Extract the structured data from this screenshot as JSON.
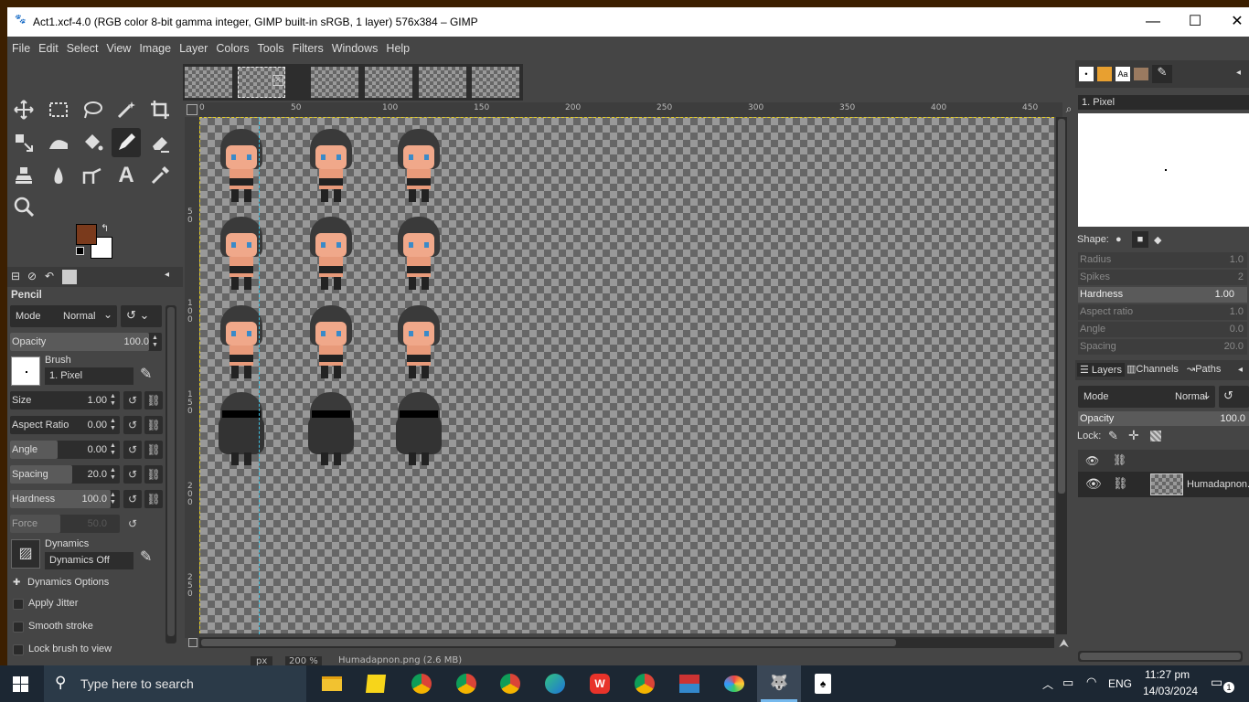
{
  "window": {
    "title": "Act1.xcf-4.0 (RGB color 8-bit gamma integer, GIMP built-in sRGB, 1 layer) 576x384 – GIMP",
    "controls": {
      "minimize": "—",
      "maximize": "☐",
      "close": "✕"
    }
  },
  "menu": [
    "File",
    "Edit",
    "Select",
    "View",
    "Image",
    "Layer",
    "Colors",
    "Tools",
    "Filters",
    "Windows",
    "Help"
  ],
  "toolbox": {
    "tool_name": "Pencil",
    "mode_label": "Mode",
    "mode_value": "Normal",
    "opacity_label": "Opacity",
    "opacity_value": "100.0",
    "brush_label": "Brush",
    "brush_value": "1. Pixel",
    "size_label": "Size",
    "size_value": "1.00",
    "aspect_label": "Aspect Ratio",
    "aspect_value": "0.00",
    "angle_label": "Angle",
    "angle_value": "0.00",
    "spacing_label": "Spacing",
    "spacing_value": "20.0",
    "hardness_label": "Hardness",
    "hardness_value": "100.0",
    "force_label": "Force",
    "force_value": "50.0",
    "dynamics_label": "Dynamics",
    "dynamics_value": "Dynamics Off",
    "dynamics_options": "Dynamics Options",
    "apply_jitter": "Apply Jitter",
    "smooth_stroke": "Smooth stroke",
    "lock_brush": "Lock brush to view",
    "fg_color": "#7a3a1c",
    "bg_color": "#ffffff"
  },
  "ruler": {
    "h_ticks": [
      "0",
      "50",
      "100",
      "150",
      "200",
      "250",
      "300",
      "350",
      "400",
      "450"
    ],
    "v_ticks": [
      "5\n0",
      "1\n0\n0",
      "1\n5\n0",
      "2\n0\n0",
      "2\n5\n0"
    ]
  },
  "statusbar": {
    "unit": "px",
    "zoom": "200 %",
    "file": "Humadapnon.png (2.6 MB)"
  },
  "brushes_panel": {
    "selected": "1. Pixel",
    "shape_label": "Shape:",
    "radius_label": "Radius",
    "radius_value": "1.0",
    "spikes_label": "Spikes",
    "spikes_value": "2",
    "hardness_label": "Hardness",
    "hardness_value": "1.00",
    "aspect_label": "Aspect ratio",
    "aspect_value": "1.0",
    "angle_label": "Angle",
    "angle_value": "0.0",
    "spacing_label": "Spacing",
    "spacing_value": "20.0"
  },
  "layers_panel": {
    "tabs": [
      "Layers",
      "Channels",
      "Paths"
    ],
    "mode_label": "Mode",
    "mode_value": "Normal",
    "opacity_label": "Opacity",
    "opacity_value": "100.0",
    "lock_label": "Lock:",
    "layer_name": "Humadapnon.png"
  },
  "taskbar": {
    "search_placeholder": "Type here to search",
    "lang": "ENG",
    "time": "11:27 pm",
    "date": "14/03/2024",
    "notif_count": "1"
  }
}
